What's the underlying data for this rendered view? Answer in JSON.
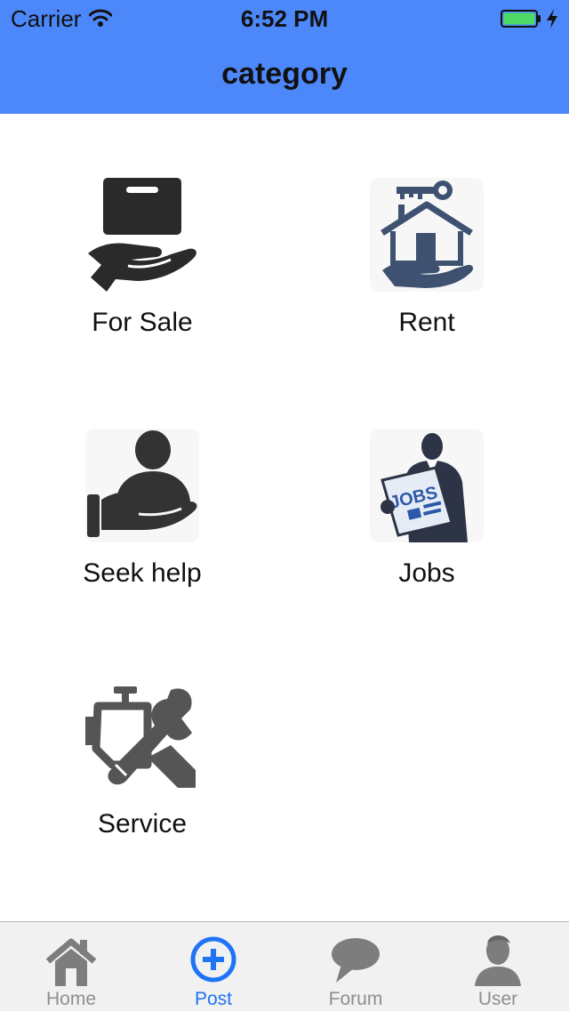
{
  "status_bar": {
    "carrier": "Carrier",
    "time": "6:52 PM"
  },
  "nav": {
    "title": "category"
  },
  "categories": [
    {
      "label": "For Sale",
      "icon": "hand-box-icon"
    },
    {
      "label": "Rent",
      "icon": "house-key-icon"
    },
    {
      "label": "Seek help",
      "icon": "person-hand-icon"
    },
    {
      "label": "Jobs",
      "icon": "newspaper-jobs-icon"
    },
    {
      "label": "Service",
      "icon": "engine-wrench-icon"
    }
  ],
  "jobs_sign": "JOBS",
  "tab_bar": {
    "active": "Post",
    "tabs": [
      {
        "label": "Home",
        "icon": "home-icon"
      },
      {
        "label": "Post",
        "icon": "plus-circle-icon"
      },
      {
        "label": "Forum",
        "icon": "chat-bubble-icon"
      },
      {
        "label": "User",
        "icon": "user-icon"
      }
    ]
  },
  "colors": {
    "nav_background": "#4d88fb",
    "tab_active": "#1f74f5",
    "tab_inactive": "#8e8e8e",
    "icon_dark": "#2a2a2a",
    "icon_slate": "#3e5170",
    "battery": "#4cd964"
  }
}
